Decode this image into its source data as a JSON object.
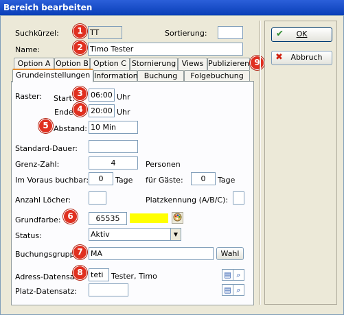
{
  "window": {
    "title": "Bereich bearbeiten"
  },
  "header": {
    "suchkuerzel_label": "Suchkürzel:",
    "suchkuerzel_value": "TT",
    "sortierung_label": "Sortierung:",
    "sortierung_value": "",
    "name_label": "Name:",
    "name_value": "Timo Tester"
  },
  "tabs_row1": [
    "Option A",
    "Option B",
    "Option C",
    "Stornierung",
    "Views",
    "Publizieren"
  ],
  "tabs_row2": [
    "Grundeinstellungen",
    "Information",
    "Buchung",
    "Folgebuchung"
  ],
  "raster": {
    "label": "Raster:",
    "start_label": "Start:",
    "start_value": "06:00",
    "start_unit": "Uhr",
    "ende_label": "Ende:",
    "ende_value": "20:00",
    "ende_unit": "Uhr",
    "abstand_label": "Abstand:",
    "abstand_value": "10 Min"
  },
  "fields": {
    "standard_dauer_label": "Standard-Dauer:",
    "standard_dauer_value": "",
    "grenz_zahl_label": "Grenz-Zahl:",
    "grenz_zahl_value": "4",
    "personen_label": "Personen",
    "voraus_label": "Im Voraus buchbar:",
    "voraus_value": "0",
    "voraus_unit": "Tage",
    "gaeste_label": "für Gäste:",
    "gaeste_value": "0",
    "gaeste_unit": "Tage",
    "loecher_label": "Anzahl Löcher:",
    "loecher_value": "",
    "platzkennung_label": "Platzkennung (A/B/C):",
    "platzkennung_value": "",
    "grundfarbe_label": "Grundfarbe:",
    "grundfarbe_value": "65535",
    "grundfarbe_color": "#ffff00",
    "status_label": "Status:",
    "status_value": "Aktiv",
    "buchungsgruppe_label": "Buchungsgruppe:",
    "buchungsgruppe_value": "MA",
    "wahl_label": "Wahl",
    "adress_label": "Adress-Datensatz:",
    "adress_value": "teti",
    "adress_name": "Tester, Timo",
    "platz_label": "Platz-Datensatz:",
    "platz_value": ""
  },
  "buttons": {
    "ok_label": "OK",
    "abbruch_label": "Abbruch"
  },
  "badges": [
    "1",
    "2",
    "3",
    "4",
    "5",
    "6",
    "7",
    "8",
    "9"
  ],
  "colors": {
    "badge": "#e03020",
    "title_bar": "#0a3fb8",
    "ok_icon": "#2e8b2e",
    "cancel_icon": "#d02010"
  }
}
